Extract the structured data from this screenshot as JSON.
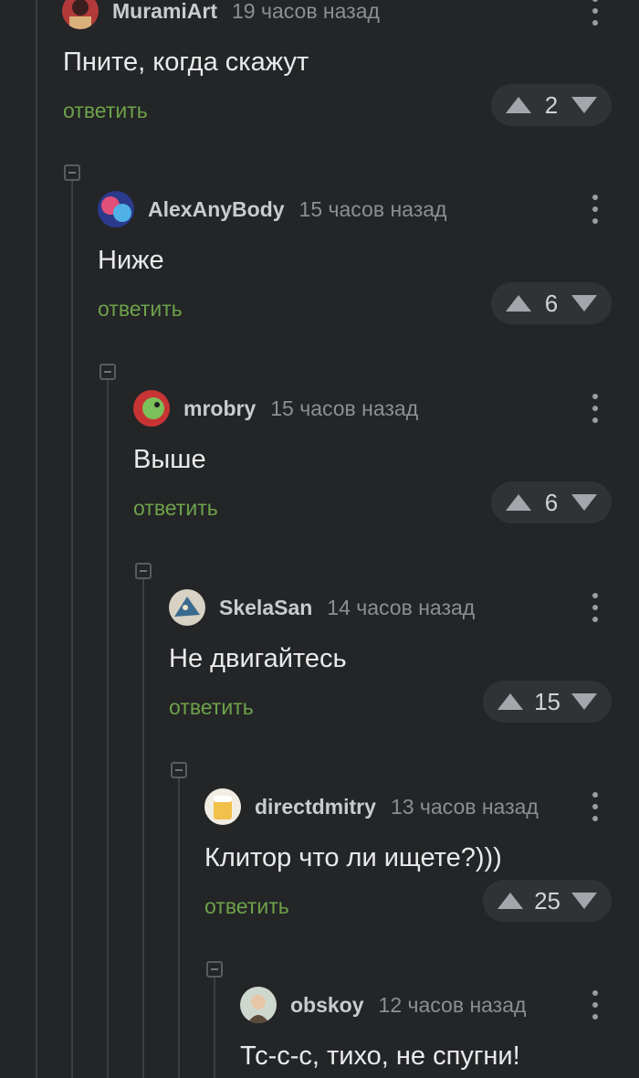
{
  "comments": [
    {
      "author": "MuramiArt",
      "time": "19 часов назад",
      "text": "Пните, когда скажут",
      "reply": "ответить",
      "score": "2",
      "avatar": "avatar-muramiart"
    },
    {
      "author": "AlexAnyBody",
      "time": "15 часов назад",
      "text": "Ниже",
      "reply": "ответить",
      "score": "6",
      "avatar": "avatar-alexanybody"
    },
    {
      "author": "mrobry",
      "time": "15 часов назад",
      "text": "Выше",
      "reply": "ответить",
      "score": "6",
      "avatar": "avatar-mrobry"
    },
    {
      "author": "SkelaSan",
      "time": "14 часов назад",
      "text": "Не двигайтесь",
      "reply": "ответить",
      "score": "15",
      "avatar": "avatar-skelasan"
    },
    {
      "author": "directdmitry",
      "time": "13 часов назад",
      "text": "Клитор что ли ищете?)))",
      "reply": "ответить",
      "score": "25",
      "avatar": "avatar-directdmitry"
    },
    {
      "author": "obskoy",
      "time": "12 часов назад",
      "text": "Тс-с-с, тихо, не спугни!",
      "avatar": "avatar-obskoy"
    }
  ],
  "colors": {
    "background": "#232527",
    "reply": "#6ea24a",
    "thread_line": "#3b3e42",
    "vote_pill": "#303336"
  }
}
